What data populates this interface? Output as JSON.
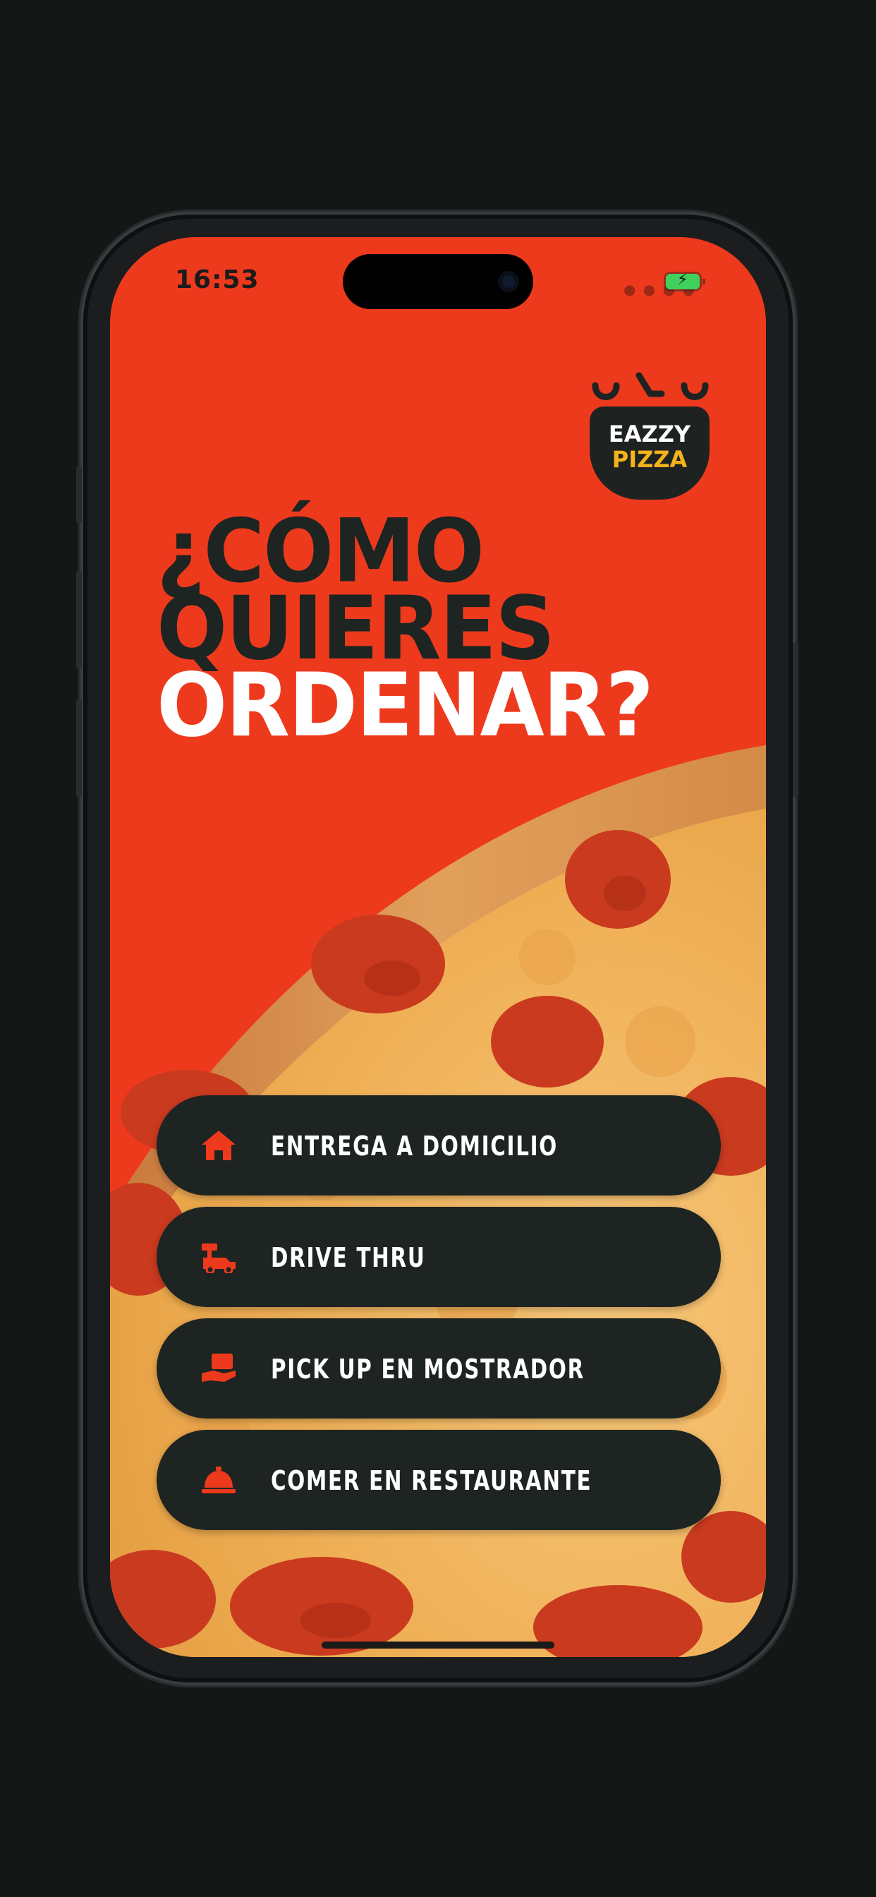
{
  "status_bar": {
    "time": "16:53"
  },
  "brand": {
    "line1": "EAZZY",
    "line2": "PIZZA"
  },
  "headline": {
    "line1": "¿CÓMO",
    "line2": "QUIERES",
    "line3": "ORDENAR?"
  },
  "options": [
    {
      "label": "ENTREGA A DOMICILIO",
      "icon": "house-icon"
    },
    {
      "label": "DRIVE THRU",
      "icon": "car-icon"
    },
    {
      "label": "PICK UP EN MOSTRADOR",
      "icon": "hand-bag-icon"
    },
    {
      "label": "COMER EN RESTAURANTE",
      "icon": "service-bell-icon"
    }
  ],
  "colors": {
    "background": "#ee3a1c",
    "button": "#1e2422",
    "accent_icon": "#ee3a1c",
    "brand_yellow": "#f6b21b"
  }
}
